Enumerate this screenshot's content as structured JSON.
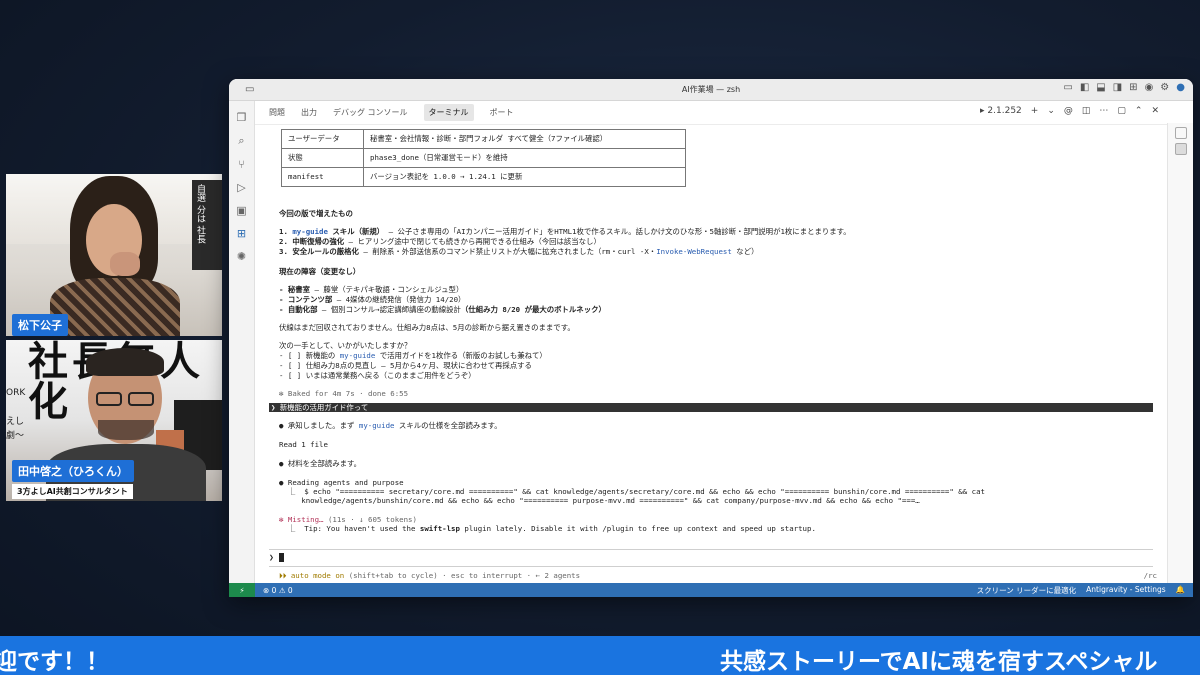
{
  "participants": [
    {
      "name": "松下公子",
      "book_text": "自選 分は 社長"
    },
    {
      "name": "田中啓之（ひろくん）",
      "subtitle": "3方よしAI共創コンサルタント",
      "bg_text": "社長無人化",
      "bg_small1": "ORK",
      "bg_small2": "えし",
      "bg_small3": "劇〜"
    }
  ],
  "window": {
    "title": "AI作業場 — zsh",
    "panel_tabs": [
      "問題",
      "出力",
      "デバッグ コンソール",
      "ターミナル",
      "ポート"
    ],
    "active_tab": "ターミナル",
    "terminal_label": "2.1.252",
    "tool_icons": [
      "+",
      "⌄",
      "@",
      "◫",
      "⋯",
      "▢",
      "⌃",
      "✕"
    ]
  },
  "table": [
    {
      "key": "ユーザーデータ",
      "value": "秘書室・会社情報・診断・部門フォルダ すべて健全（7ファイル確認）"
    },
    {
      "key": "状態",
      "value": "phase3_done（日常運営モード）を維持"
    },
    {
      "key": "manifest",
      "value": "バージョン表記を 1.0.0 → 1.24.1 に更新"
    }
  ],
  "terminal": {
    "new_heading": "今回の版で増えたもの",
    "new1_num": "1. ",
    "new1_link": "my-guide",
    "new1_bold": " スキル（新規）",
    "new1_rest": " — 公子さま専用の「AIカンパニー活用ガイド」をHTML1枚で作るスキル。話しかけ文のひな形・5軸診断・部門説明が1枚にまとまります。",
    "new2_num": "2. ",
    "new2_bold": "中断復帰の強化",
    "new2_rest": " — ヒアリング途中で閉じても続きから再開できる仕組み（今回は該当なし）",
    "new3_num": "3. ",
    "new3_bold": "安全ルールの厳格化",
    "new3_rest": " — 削除系・外部送信系のコマンド禁止リストが大幅に拡充されました（rm・curl -X・",
    "new3_link": "Invoke-WebRequest",
    "new3_end": " など）",
    "cur_heading": "現在の陣容（変更なし）",
    "cur1_bold": "- 秘書室",
    "cur1_rest": " — 藤堂（テキパキ敬語・コンシェルジュ型）",
    "cur2_bold": "- コンテンツ部",
    "cur2_rest": " — 4媒体の継続発信（発信力 14/20）",
    "cur3_bold": "- 自動化部",
    "cur3_rest": " — 個別コンサル→認定講師講座の動線設計",
    "cur3_bold2": "（仕組み力 8/20 が最大のボトルネック）",
    "homework": "伏線はまだ回収されておりません。仕組み力8点は、5月の診断から据え置きのままです。",
    "next_heading": "次の一手として、いかがいたしますか？",
    "opt1_pre": "- [ ] 新機能の ",
    "opt1_link": "my-guide",
    "opt1_rest": " で活用ガイドを1枚作る（新版のお試しも兼ねて）",
    "opt2": "- [ ] 仕組み力8点の見直し — 5月から4ヶ月、現状に合わせて再採点する",
    "opt3": "- [ ] いまは通常業務へ戻る（このままご用件をどうぞ）",
    "baked": "✻ Baked for 4m 7s · done 6:55",
    "user_prompt": "❯ 新機能の活用ガイド作って",
    "ack_pre": "● 承知しました。まず ",
    "ack_link": "my-guide",
    "ack_rest": " スキルの仕様を全部読みます。",
    "read_file": "Read 1 file",
    "materials": "● 材料を全部読みます。",
    "reading": "● Reading agents and purpose",
    "cmd1": "  ⎿  $ echo \"========== secretary/core.md ==========\" && cat knowledge/agents/secretary/core.md && echo && echo \"========== bunshin/core.md ==========\" && cat",
    "cmd2": "     knowledge/agents/bunshin/core.md && echo && echo \"========== purpose-mvv.md ==========\" && cat company/purpose-mvv.md && echo && echo \"===…",
    "misting_pre": "✻ Misting…",
    "misting_rest": " (11s · ↓ 605 tokens)",
    "tip_pre": "  ⎿  Tip: You haven't used the ",
    "tip_bold": "swift-lsp",
    "tip_rest": " plugin lately. Disable it with /plugin to free up context and speed up startup.",
    "input_prompt": "❯",
    "auto_mode_pre": "⏵⏵ auto mode on",
    "auto_mode_rest": " (shift+tab to cycle) · esc to interrupt · ← 2 agents",
    "rc": "/rc"
  },
  "status_bar": {
    "problems": "⊗ 0 ⚠ 0",
    "screen_reader": "スクリーン リーダーに最適化",
    "antigravity": "Antigravity - Settings",
    "bell": "🔔"
  },
  "ticker": {
    "left": "迎です！！",
    "right": "共感ストーリーでAIに魂を宿すスペシャル"
  }
}
